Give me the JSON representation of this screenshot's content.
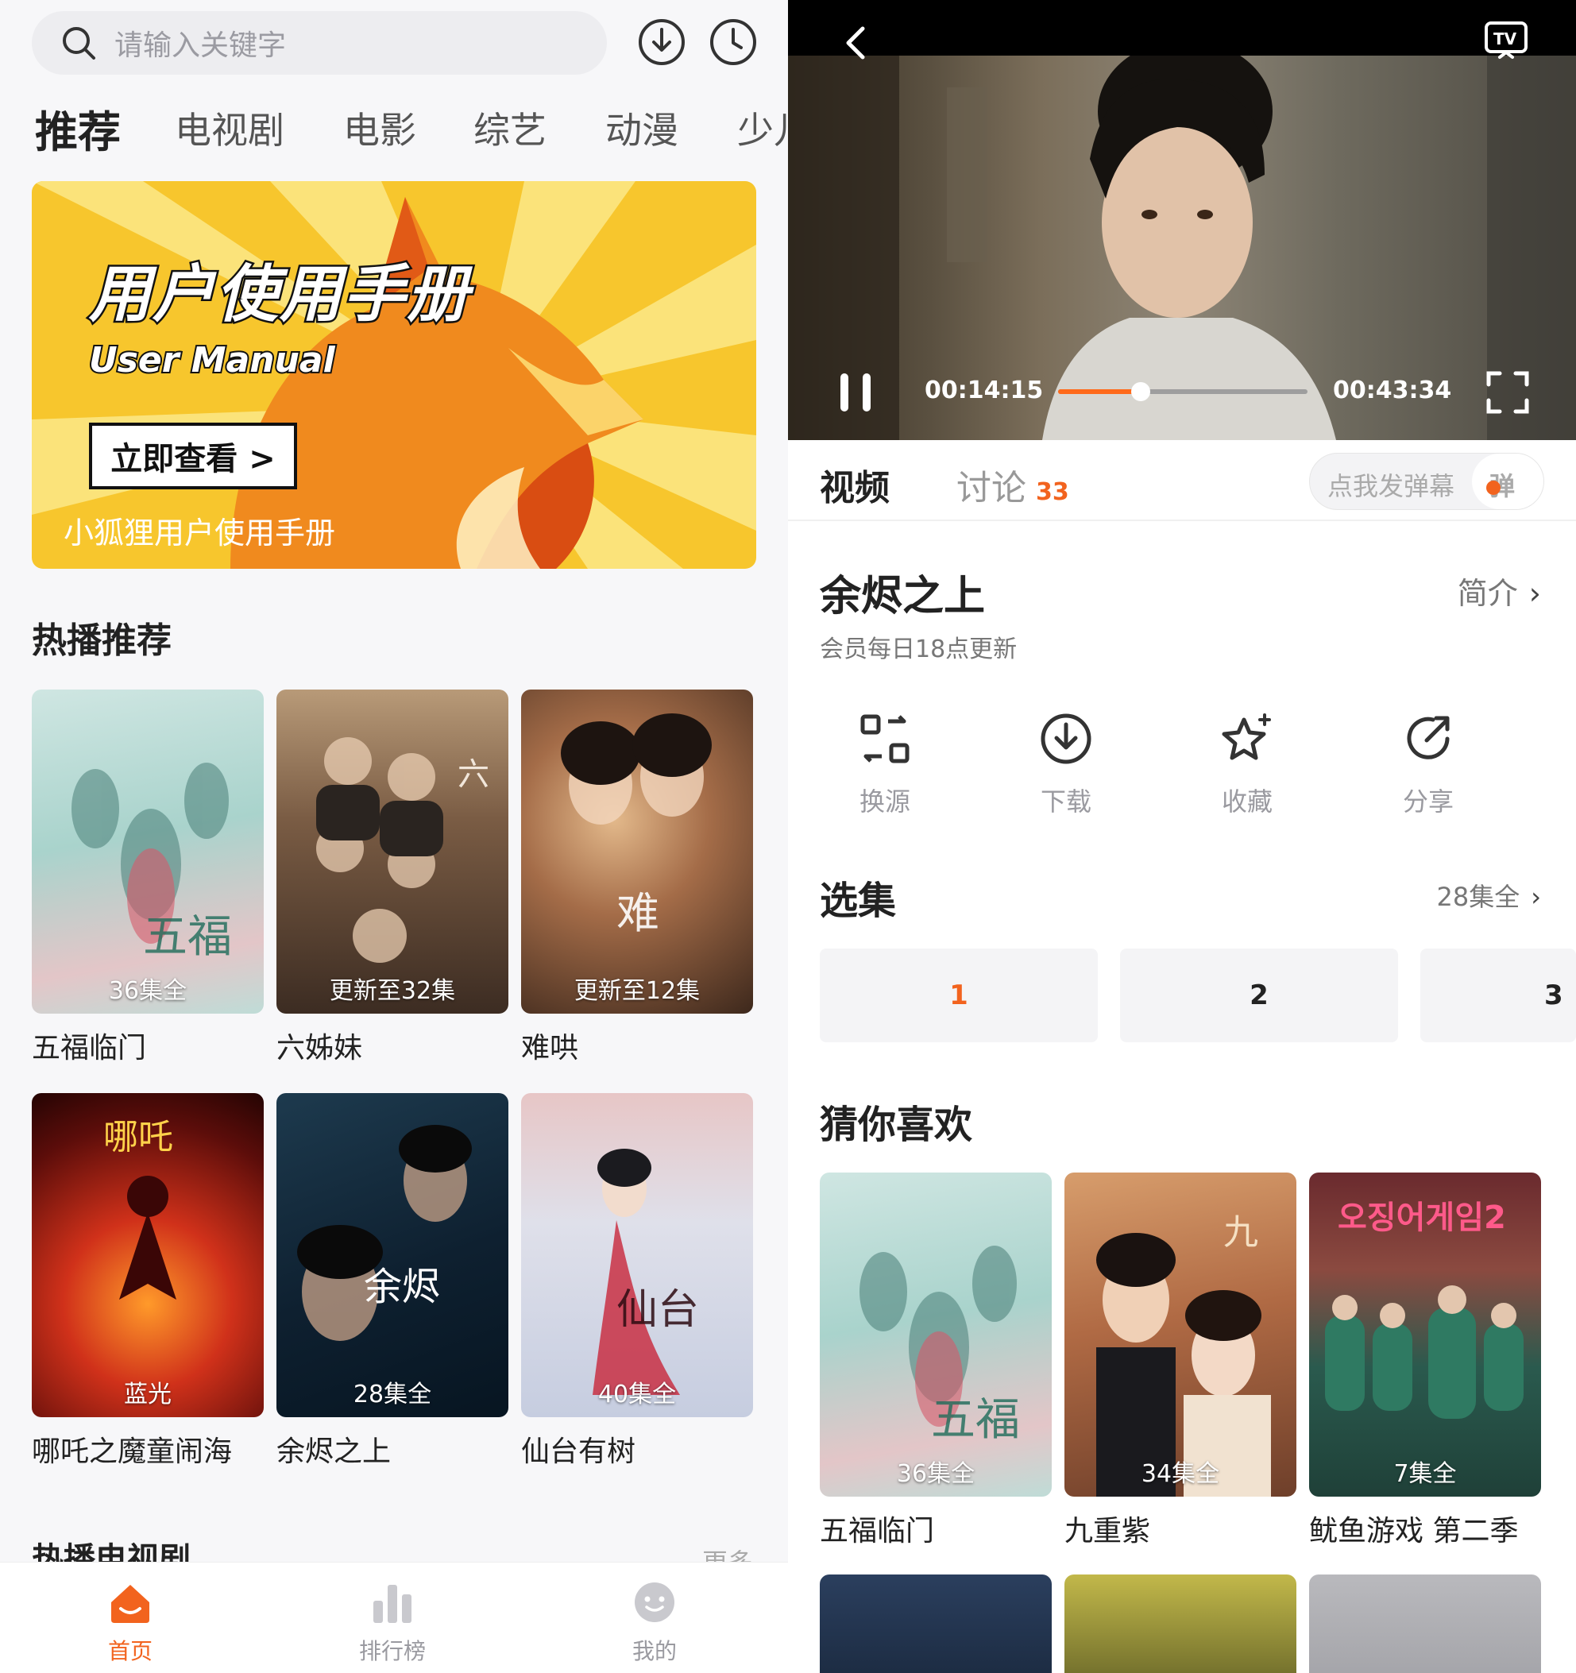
{
  "left": {
    "search": {
      "placeholder": "请输入关键字"
    },
    "tabs": [
      "推荐",
      "电视剧",
      "电影",
      "综艺",
      "动漫",
      "少儿"
    ],
    "banner": {
      "title": "用户使用手册",
      "subtitle": "User Manual",
      "button": "立即查看 >",
      "caption": "小狐狸用户使用手册"
    },
    "hot_title": "热播推荐",
    "cards": [
      {
        "name": "五福临门",
        "badge": "36集全"
      },
      {
        "name": "六姊妹",
        "badge": "更新至32集"
      },
      {
        "name": "难哄",
        "badge": "更新至12集"
      },
      {
        "name": "哪吒之魔童闹海",
        "badge": "蓝光"
      },
      {
        "name": "余烬之上",
        "badge": "28集全"
      },
      {
        "name": "仙台有树",
        "badge": "40集全"
      }
    ],
    "next_section": {
      "title": "热播电视剧",
      "more": "更多"
    },
    "nav": [
      {
        "label": "首页",
        "icon": "home-icon"
      },
      {
        "label": "排行榜",
        "icon": "ranking-icon"
      },
      {
        "label": "我的",
        "icon": "profile-icon"
      }
    ],
    "accent": "#f2631e"
  },
  "right": {
    "player": {
      "current": "00:14:15",
      "duration": "00:43:34",
      "progress": 0.33
    },
    "tabs": {
      "video": "视频",
      "discuss": "讨论",
      "discuss_count": "33"
    },
    "danmu": {
      "placeholder": "点我发弹幕",
      "button": "弹"
    },
    "show": {
      "title": "余烬之上",
      "intro": "简介",
      "update": "会员每日18点更新"
    },
    "actions": [
      "换源",
      "下载",
      "收藏",
      "分享"
    ],
    "episodes": {
      "title": "选集",
      "total": "28集全",
      "items": [
        "1",
        "2",
        "3"
      ]
    },
    "like": {
      "title": "猜你喜欢",
      "cards": [
        {
          "name": "五福临门",
          "badge": "36集全"
        },
        {
          "name": "九重紫",
          "badge": "34集全"
        },
        {
          "name": "鱿鱼游戏 第二季",
          "badge": "7集全"
        }
      ]
    }
  }
}
